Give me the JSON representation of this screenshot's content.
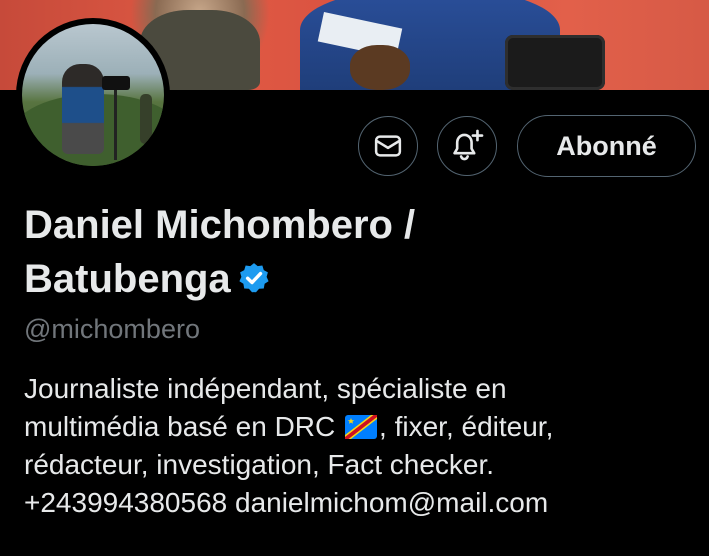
{
  "profile": {
    "display_name_line1": "Daniel Michombero /",
    "display_name_line2": "Batubenga",
    "handle": "@michombero",
    "bio_line1": "Journaliste indépendant, spécialiste en",
    "bio_line2_before_flag": "multimédia basé en DRC",
    "bio_line2_after_flag": ", fixer, éditeur,",
    "bio_line3": "rédacteur, investigation, Fact checker.",
    "bio_line4": "+243994380568 danielmichom@mail.com",
    "verified_icon": "verified-badge-icon",
    "flag_icon": "drc-flag-icon"
  },
  "actions": {
    "follow_label": "Abonné",
    "message_icon": "envelope-icon",
    "notify_icon": "bell-plus-icon"
  },
  "colors": {
    "background": "#000000",
    "text": "#e7e9ea",
    "muted": "#71767b",
    "border": "#536471",
    "verified": "#1d9bf0"
  }
}
